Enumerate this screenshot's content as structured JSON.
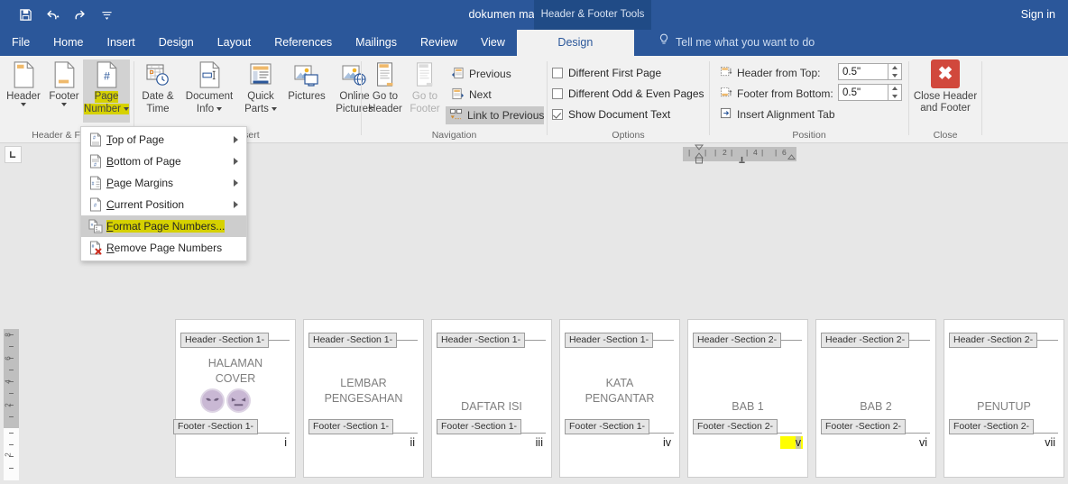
{
  "titlebar": {
    "document_title": "dokumen makalah - Word",
    "contextual_tab_label": "Header & Footer Tools",
    "sign_in": "Sign in",
    "quick_access": [
      {
        "name": "save-icon",
        "label": "Save"
      },
      {
        "name": "undo-icon",
        "label": "Undo"
      },
      {
        "name": "redo-icon",
        "label": "Redo"
      },
      {
        "name": "customize-quick-access-icon",
        "label": "Customize Quick Access Toolbar"
      }
    ]
  },
  "tabs": [
    {
      "label": "File",
      "active": false
    },
    {
      "label": "Home",
      "active": false
    },
    {
      "label": "Insert",
      "active": false
    },
    {
      "label": "Design",
      "active": false
    },
    {
      "label": "Layout",
      "active": false
    },
    {
      "label": "References",
      "active": false
    },
    {
      "label": "Mailings",
      "active": false
    },
    {
      "label": "Review",
      "active": false
    },
    {
      "label": "View",
      "active": false
    },
    {
      "label": "Design",
      "active": true
    }
  ],
  "tellme": {
    "text": "Tell me what you want to do",
    "icon": "lightbulb-icon"
  },
  "ribbon": {
    "groups": [
      {
        "label": "Header & Footer"
      },
      {
        "label": "Insert"
      },
      {
        "label": "Navigation"
      },
      {
        "label": "Options"
      },
      {
        "label": "Position"
      },
      {
        "label": "Close"
      }
    ],
    "header_footer": {
      "header": {
        "label": "Header",
        "icon": "header-page-icon"
      },
      "footer": {
        "label": "Footer",
        "icon": "footer-page-icon"
      },
      "page_number": {
        "label_line1": "Page",
        "label_line2": "Number",
        "icon": "page-number-icon",
        "highlighted": true,
        "selected": true
      }
    },
    "insert": {
      "date_time": {
        "label_line1": "Date &",
        "label_line2": "Time",
        "icon": "calendar-clock-icon"
      },
      "document_info": {
        "label_line1": "Document",
        "label_line2": "Info",
        "icon": "document-info-icon"
      },
      "quick_parts": {
        "label_line1": "Quick",
        "label_line2": "Parts",
        "icon": "quick-parts-icon"
      },
      "pictures": {
        "label_line1": "Pictures",
        "label_line2": "",
        "icon": "pictures-icon"
      },
      "online_pictures": {
        "label_line1": "Online",
        "label_line2": "Pictures",
        "icon": "online-pictures-icon"
      }
    },
    "navigation": {
      "go_to_header": {
        "label_line1": "Go to",
        "label_line2": "Header",
        "icon": "go-to-header-icon"
      },
      "go_to_footer": {
        "label_line1": "Go to",
        "label_line2": "Footer",
        "icon": "go-to-footer-icon",
        "disabled": true
      },
      "previous": {
        "label": "Previous",
        "icon": "previous-section-icon"
      },
      "next": {
        "label": "Next",
        "icon": "next-section-icon"
      },
      "link_to_previous": {
        "label": "Link to Previous",
        "icon": "link-to-previous-icon",
        "selected": true
      }
    },
    "options": {
      "different_first_page": {
        "label": "Different First Page",
        "checked": false
      },
      "different_odd_even": {
        "label": "Different Odd & Even Pages",
        "checked": false
      },
      "show_document_text": {
        "label": "Show Document Text",
        "checked": true
      }
    },
    "position": {
      "header_from_top": {
        "label": "Header from Top:",
        "value": "0.5\"",
        "icon": "header-from-top-icon"
      },
      "footer_from_bottom": {
        "label": "Footer from Bottom:",
        "value": "0.5\"",
        "icon": "footer-from-bottom-icon"
      },
      "insert_alignment_tab": {
        "label": "Insert Alignment Tab",
        "icon": "alignment-tab-icon"
      }
    },
    "close": {
      "label_line1": "Close Header",
      "label_line2": "and Footer",
      "icon": "close-x-icon",
      "accent_color": "#d1483c"
    }
  },
  "page_number_menu": {
    "items": [
      {
        "label": "Top of Page",
        "icon": "top-of-page-icon",
        "submenu": true,
        "hovered": false,
        "highlighted": false
      },
      {
        "label": "Bottom of Page",
        "icon": "bottom-of-page-icon",
        "submenu": true,
        "hovered": false,
        "highlighted": false
      },
      {
        "label": "Page Margins",
        "icon": "page-margins-icon",
        "submenu": true,
        "hovered": false,
        "highlighted": false
      },
      {
        "label": "Current Position",
        "icon": "current-position-icon",
        "submenu": true,
        "hovered": false,
        "highlighted": false
      },
      {
        "label": "Format Page Numbers...",
        "icon": "format-page-numbers-icon",
        "submenu": false,
        "hovered": true,
        "highlighted": true
      },
      {
        "label": "Remove Page Numbers",
        "icon": "remove-page-numbers-icon",
        "submenu": false,
        "hovered": false,
        "highlighted": false
      }
    ]
  },
  "rulers": {
    "tab_selector": "left-tab-stop",
    "horizontal_ticks": [
      "1",
      "2",
      "4",
      "6"
    ],
    "vertical_ticks": [
      "8",
      "6",
      "4",
      "2",
      "2"
    ]
  },
  "document": {
    "pages": [
      {
        "header_tag": "Header -Section 1-",
        "footer_tag": "Footer -Section 1-",
        "title_lines": [
          "HALAMAN",
          "COVER"
        ],
        "page_number": "i",
        "has_images": true,
        "number_highlighted": false
      },
      {
        "header_tag": "Header -Section 1-",
        "footer_tag": "Footer -Section 1-",
        "title_lines": [
          "LEMBAR",
          "PENGESAHAN"
        ],
        "page_number": "ii",
        "has_images": false,
        "number_highlighted": false
      },
      {
        "header_tag": "Header -Section 1-",
        "footer_tag": "Footer -Section 1-",
        "title_lines": [
          "DAFTAR ISI"
        ],
        "page_number": "iii",
        "has_images": false,
        "number_highlighted": false
      },
      {
        "header_tag": "Header -Section 1-",
        "footer_tag": "Footer -Section 1-",
        "title_lines": [
          "KATA",
          "PENGANTAR"
        ],
        "page_number": "iv",
        "has_images": false,
        "number_highlighted": false
      },
      {
        "header_tag": "Header -Section 2-",
        "footer_tag": "Footer -Section 2-",
        "title_lines": [
          "BAB 1"
        ],
        "page_number": "v",
        "has_images": false,
        "number_highlighted": true
      },
      {
        "header_tag": "Header -Section 2-",
        "footer_tag": "Footer -Section 2-",
        "title_lines": [
          "BAB 2"
        ],
        "page_number": "vi",
        "has_images": false,
        "number_highlighted": false
      },
      {
        "header_tag": "Header -Section 2-",
        "footer_tag": "Footer -Section 2-",
        "title_lines": [
          "PENUTUP"
        ],
        "page_number": "vii",
        "has_images": false,
        "number_highlighted": false
      }
    ]
  },
  "colors": {
    "title_bar": "#2b579a",
    "contextual_tab": "#204b86",
    "ribbon_bg": "#f1f1f1",
    "doc_bg": "#e7e7e7",
    "highlight_yellow": "#d6d100",
    "selection_yellow": "#ffff00",
    "close_red": "#d1483c"
  }
}
